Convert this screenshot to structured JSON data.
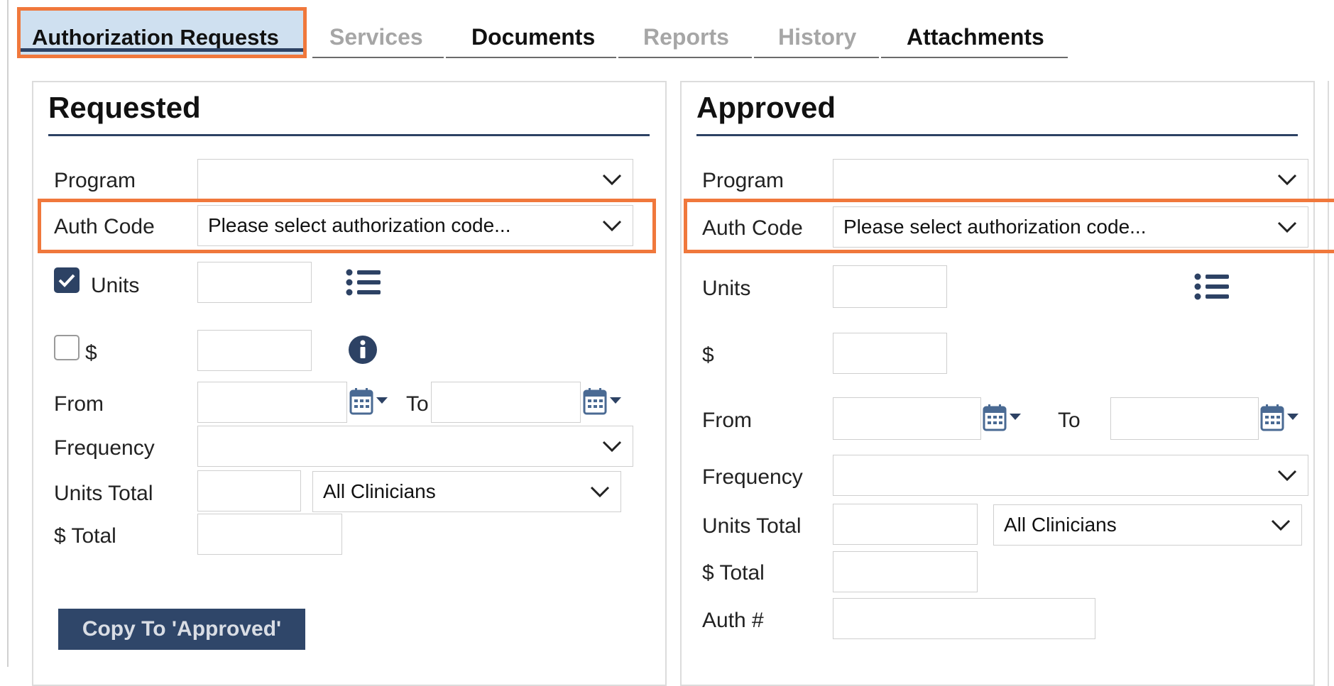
{
  "tabs": {
    "active": "Authorization Requests",
    "items": [
      {
        "label": "Services",
        "enabled": false
      },
      {
        "label": "Documents",
        "enabled": true
      },
      {
        "label": "Reports",
        "enabled": false
      },
      {
        "label": "History",
        "enabled": false
      },
      {
        "label": "Attachments",
        "enabled": true
      }
    ]
  },
  "requested": {
    "title": "Requested",
    "program_label": "Program",
    "program_value": "",
    "auth_code_label": "Auth Code",
    "auth_code_value": "Please select authorization code...",
    "units_label": "Units",
    "units_checked": true,
    "dollar_label": "$",
    "dollar_checked": false,
    "from_label": "From",
    "to_label": "To",
    "frequency_label": "Frequency",
    "units_total_label": "Units Total",
    "clinicians_value": "All Clinicians",
    "dollar_total_label": "$ Total",
    "copy_button": "Copy To 'Approved'"
  },
  "approved": {
    "title": "Approved",
    "program_label": "Program",
    "auth_code_label": "Auth Code",
    "auth_code_value": "Please select authorization code...",
    "units_label": "Units",
    "dollar_label": "$",
    "from_label": "From",
    "to_label": "To",
    "frequency_label": "Frequency",
    "units_total_label": "Units Total",
    "clinicians_value": "All Clinicians",
    "dollar_total_label": "$ Total",
    "auth_number_label": "Auth #"
  },
  "colors": {
    "highlight": "#f0783c",
    "accent_navy": "#2d4264",
    "active_tab_bg": "#cfe0f0",
    "disabled_text": "#a6a6a6"
  },
  "icons": [
    "chevron-down-icon",
    "list-icon",
    "info-icon",
    "calendar-icon",
    "checkbox-icon"
  ]
}
